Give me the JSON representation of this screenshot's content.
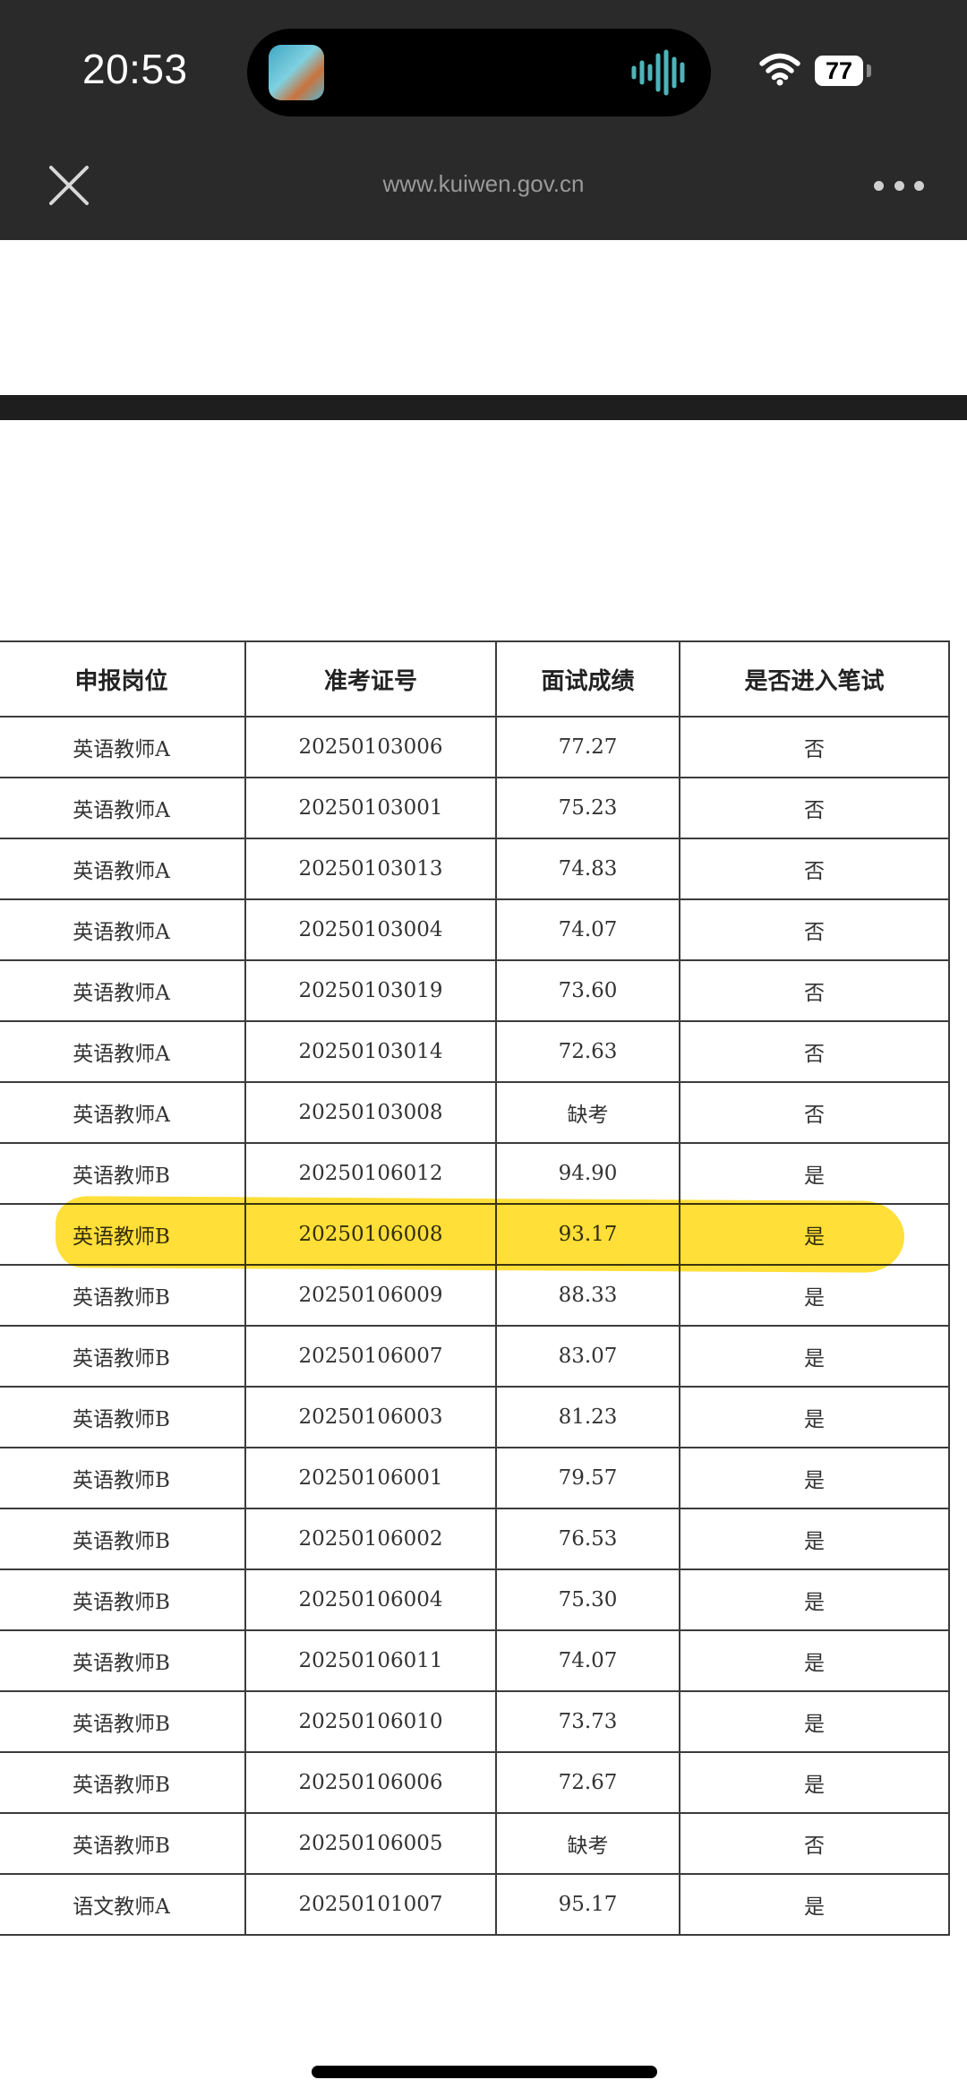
{
  "status_bar": {
    "time": "20:53",
    "battery": "77"
  },
  "browser": {
    "url": "www.kuiwen.gov.cn",
    "close_icon": "close-icon",
    "more_icon": "more-icon"
  },
  "table": {
    "headers": [
      "申报岗位",
      "准考证号",
      "面试成绩",
      "是否进入笔试"
    ],
    "rows": [
      [
        "英语教师A",
        "20250103006",
        "77.27",
        "否"
      ],
      [
        "英语教师A",
        "20250103001",
        "75.23",
        "否"
      ],
      [
        "英语教师A",
        "20250103013",
        "74.83",
        "否"
      ],
      [
        "英语教师A",
        "20250103004",
        "74.07",
        "否"
      ],
      [
        "英语教师A",
        "20250103019",
        "73.60",
        "否"
      ],
      [
        "英语教师A",
        "20250103014",
        "72.63",
        "否"
      ],
      [
        "英语教师A",
        "20250103008",
        "缺考",
        "否"
      ],
      [
        "英语教师B",
        "20250106012",
        "94.90",
        "是"
      ],
      [
        "英语教师B",
        "20250106008",
        "93.17",
        "是"
      ],
      [
        "英语教师B",
        "20250106009",
        "88.33",
        "是"
      ],
      [
        "英语教师B",
        "20250106007",
        "83.07",
        "是"
      ],
      [
        "英语教师B",
        "20250106003",
        "81.23",
        "是"
      ],
      [
        "英语教师B",
        "20250106001",
        "79.57",
        "是"
      ],
      [
        "英语教师B",
        "20250106002",
        "76.53",
        "是"
      ],
      [
        "英语教师B",
        "20250106004",
        "75.30",
        "是"
      ],
      [
        "英语教师B",
        "20250106011",
        "74.07",
        "是"
      ],
      [
        "英语教师B",
        "20250106010",
        "73.73",
        "是"
      ],
      [
        "英语教师B",
        "20250106006",
        "72.67",
        "是"
      ],
      [
        "英语教师B",
        "20250106005",
        "缺考",
        "否"
      ],
      [
        "语文教师A",
        "20250101007",
        "95.17",
        "是"
      ]
    ],
    "highlighted_row_index": 8,
    "highlight_color": "#ffd600"
  }
}
